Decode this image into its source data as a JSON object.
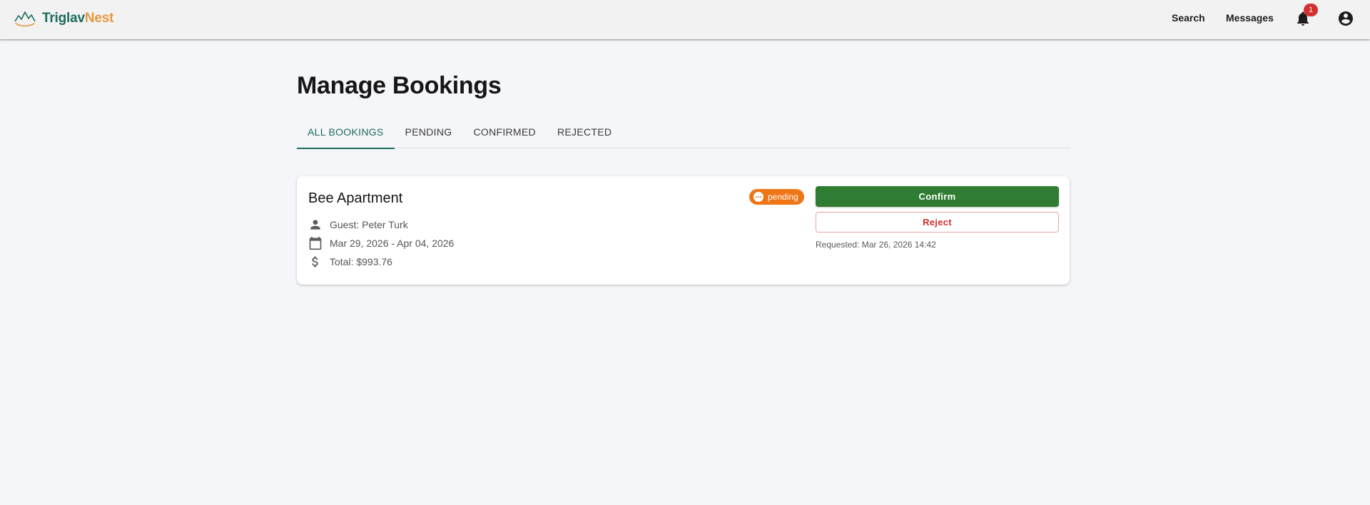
{
  "brand": {
    "name_part1": "Triglav",
    "name_part2": "Nest",
    "colors": {
      "primary": "#1d6b5c",
      "accent": "#e89a3f"
    }
  },
  "header": {
    "search_label": "Search",
    "messages_label": "Messages",
    "notifications": {
      "icon": "bell-icon",
      "count": "1"
    },
    "account_icon": "account-circle-icon"
  },
  "page": {
    "title": "Manage Bookings"
  },
  "tabs": [
    {
      "label": "ALL BOOKINGS",
      "active": true
    },
    {
      "label": "PENDING",
      "active": false
    },
    {
      "label": "CONFIRMED",
      "active": false
    },
    {
      "label": "REJECTED",
      "active": false
    }
  ],
  "booking": {
    "property": "Bee Apartment",
    "status": "pending",
    "status_color": "#ef7617",
    "guest": "Guest: Peter Turk",
    "dates": "Mar 29, 2026 - Apr 04, 2026",
    "total": "Total: $993.76",
    "confirm_label": "Confirm",
    "reject_label": "Reject",
    "requested": "Requested: Mar 26, 2026 14:42",
    "colors": {
      "confirm": "#2e7d32",
      "reject": "#d32f2f"
    }
  }
}
